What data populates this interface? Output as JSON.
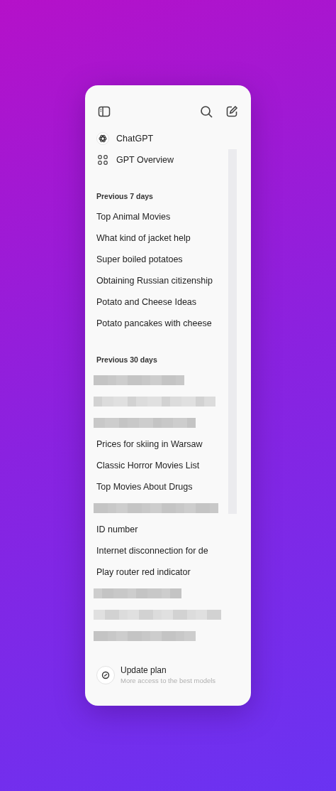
{
  "top_links": [
    {
      "kind": "logo",
      "label": "ChatGPT"
    },
    {
      "kind": "grid",
      "label": "GPT Overview"
    }
  ],
  "sections": [
    {
      "title": "Previous 7 days",
      "items": [
        {
          "kind": "chat",
          "title": "Top Animal Movies"
        },
        {
          "kind": "chat",
          "title": "What kind of jacket help"
        },
        {
          "kind": "chat",
          "title": "Super boiled potatoes"
        },
        {
          "kind": "chat",
          "title": "Obtaining Russian citizenship"
        },
        {
          "kind": "chat",
          "title": "Potato and Cheese Ideas"
        },
        {
          "kind": "chat",
          "title": "Potato pancakes with cheese"
        }
      ]
    },
    {
      "title": "Previous 30 days",
      "items": [
        {
          "kind": "redacted"
        },
        {
          "kind": "redacted"
        },
        {
          "kind": "redacted"
        },
        {
          "kind": "chat",
          "title": "Prices for skiing in Warsaw"
        },
        {
          "kind": "chat",
          "title": "Classic Horror Movies List"
        },
        {
          "kind": "chat",
          "title": "Top Movies About Drugs"
        },
        {
          "kind": "redacted"
        },
        {
          "kind": "chat",
          "title": "ID number"
        },
        {
          "kind": "chat",
          "title": "Internet disconnection for de"
        },
        {
          "kind": "chat",
          "title": "Play router red indicator"
        },
        {
          "kind": "redacted"
        },
        {
          "kind": "redacted"
        },
        {
          "kind": "redacted"
        }
      ]
    }
  ],
  "upgrade": {
    "title": "Update plan",
    "subtitle": "More access to the best models"
  }
}
